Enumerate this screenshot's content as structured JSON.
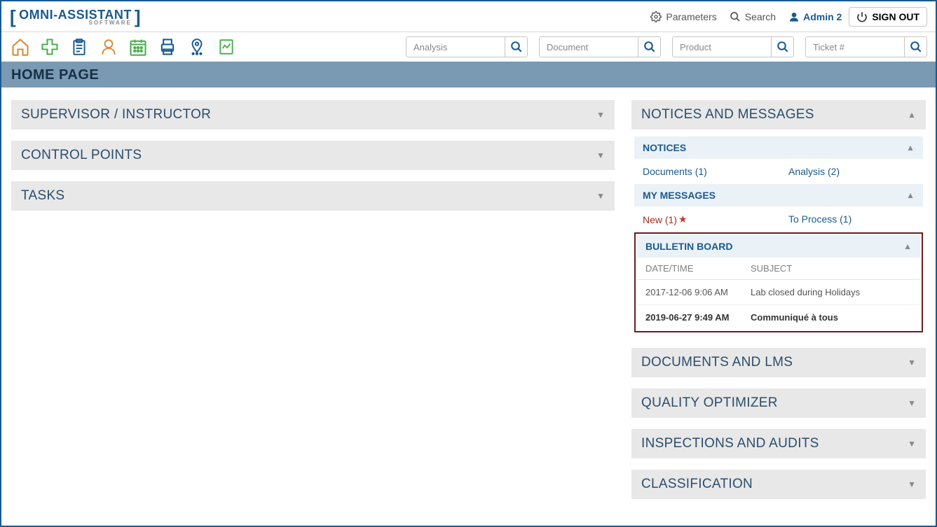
{
  "logo": {
    "title": "OMNI-ASSISTANT",
    "subtitle": "SOFTWARE"
  },
  "top": {
    "parameters": "Parameters",
    "search": "Search",
    "user": "Admin 2",
    "signout": "SIGN OUT"
  },
  "searchbar": {
    "analysis": "Analysis",
    "document": "Document",
    "product": "Product",
    "ticket": "Ticket #"
  },
  "pageTitle": "HOME PAGE",
  "leftPanels": {
    "supervisor": "SUPERVISOR / INSTRUCTOR",
    "control": "CONTROL POINTS",
    "tasks": "TASKS"
  },
  "rightPanels": {
    "notices": "NOTICES AND MESSAGES",
    "documents_lms": "DOCUMENTS AND LMS",
    "quality": "QUALITY OPTIMIZER",
    "inspections": "INSPECTIONS AND AUDITS",
    "classification": "CLASSIFICATION"
  },
  "notices_sub": {
    "notices_title": "NOTICES",
    "documents_link": "Documents (1)",
    "analysis_link": "Analysis (2)"
  },
  "messages_sub": {
    "title": "MY MESSAGES",
    "new": "New (1)",
    "process": "To Process (1)"
  },
  "bulletin": {
    "title": "BULLETIN BOARD",
    "col_date": "DATE/TIME",
    "col_subject": "SUBJECT",
    "rows": [
      {
        "date": "2017-12-06 9:06 AM",
        "subject": "Lab closed during Holidays"
      },
      {
        "date": "2019-06-27 9:49 AM",
        "subject": "Communiqué à tous"
      }
    ]
  }
}
